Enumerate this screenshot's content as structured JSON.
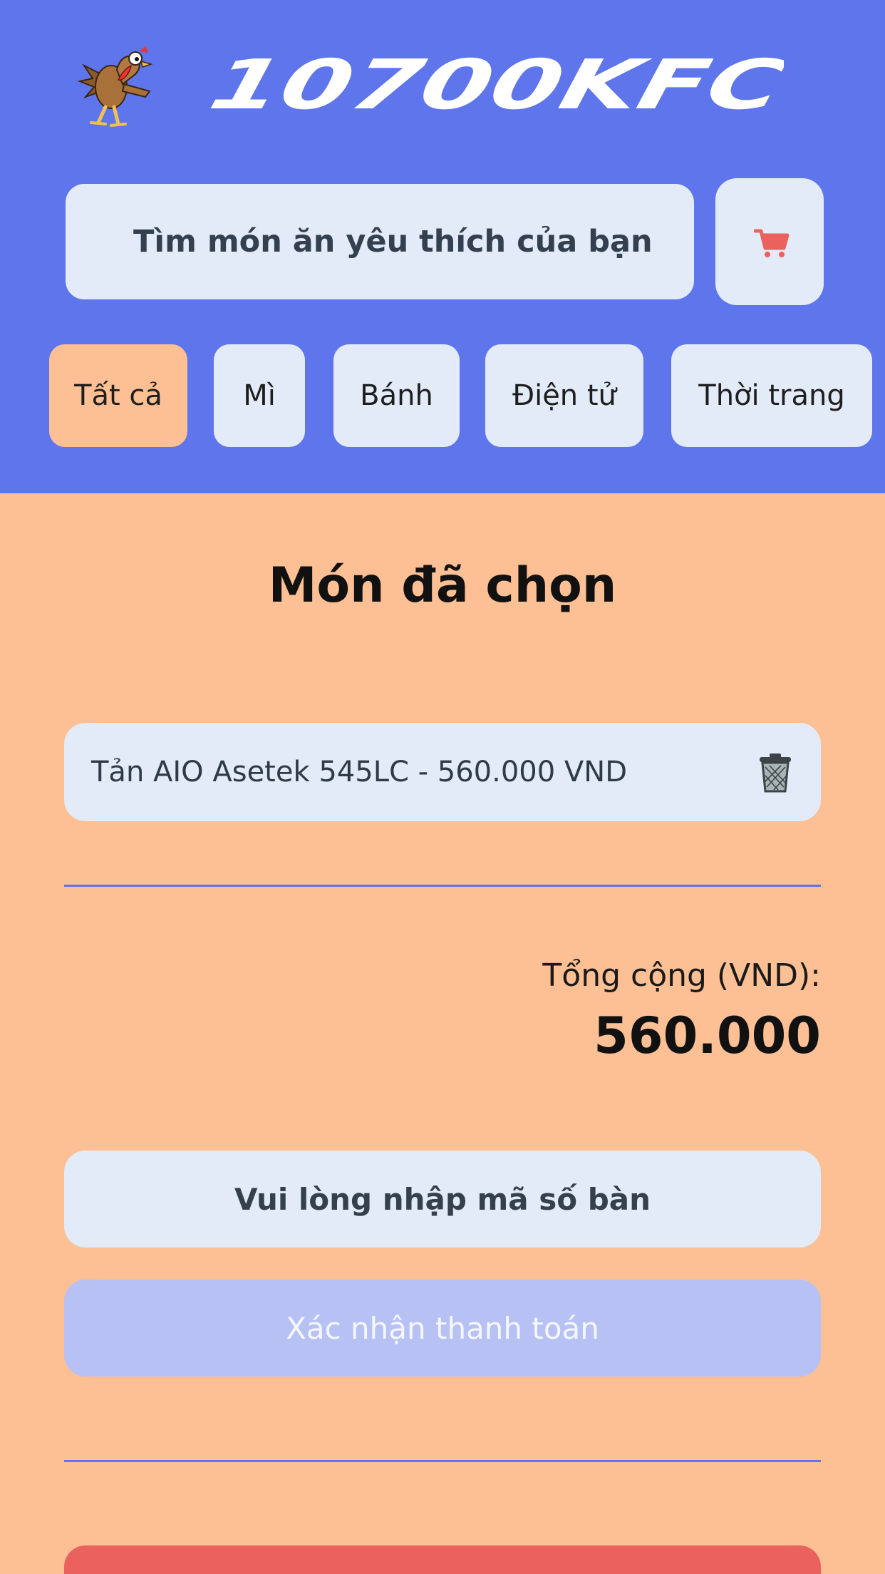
{
  "header": {
    "brand": "10700KFC",
    "search": {
      "placeholder": "Tìm món ăn yêu thích của bạn",
      "value": ""
    },
    "cart_icon": "cart-icon",
    "categories": [
      {
        "label": "Tất cả",
        "active": true
      },
      {
        "label": "Mì",
        "active": false
      },
      {
        "label": "Bánh",
        "active": false
      },
      {
        "label": "Điện tử",
        "active": false
      },
      {
        "label": "Thời trang",
        "active": false
      }
    ]
  },
  "cart": {
    "title": "Món đã chọn",
    "items": [
      {
        "label": "Tản AIO Asetek 545LC - 560.000 VND",
        "icon": "trash-icon"
      }
    ],
    "total_label": "Tổng cộng (VND):",
    "total_value": "560.000",
    "table_button": "Vui lòng nhập mã số bàn",
    "confirm_button": "Xác nhận thanh toán"
  },
  "colors": {
    "header_bg": "#5f75ec",
    "page_bg": "#fdbf94",
    "chip_bg": "#e2ebf7",
    "confirm_disabled": "#b8c1f3",
    "danger": "#eb615d"
  }
}
